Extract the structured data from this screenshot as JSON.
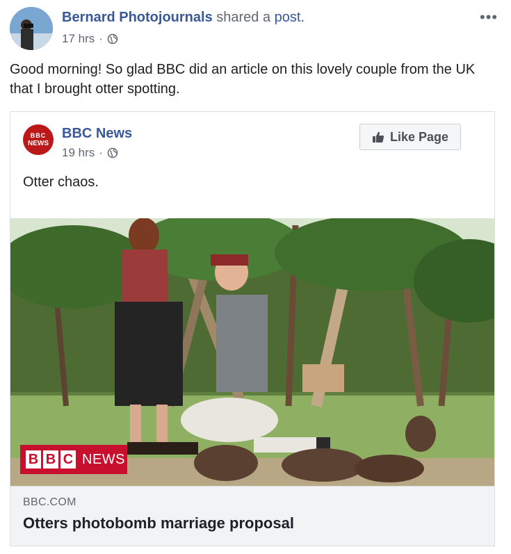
{
  "post": {
    "author_name": "Bernard Photojournals",
    "author_action": "shared a",
    "author_link": "post.",
    "time": "17 hrs",
    "dot": "·",
    "more_icon": "more-horizontal-icon",
    "text": "Good morning! So glad BBC did an article on this lovely couple from the UK that I brought otter spotting."
  },
  "shared": {
    "page_name": "BBC News",
    "logo_line1": "BBC",
    "logo_line2": "NEWS",
    "time": "19 hrs",
    "dot": "·",
    "like_label": "Like Page",
    "like_icon": "thumbs-up-icon",
    "text": "Otter chaos.",
    "photo_banner": {
      "letters": [
        "B",
        "B",
        "C"
      ],
      "word": "NEWS"
    },
    "link_domain": "BBC.COM",
    "link_title": "Otters photobomb marriage proposal"
  },
  "colors": {
    "link_blue": "#385898",
    "meta_gray": "#606770",
    "bbc_red": "#bb1919",
    "link_box_bg": "#f2f3f5"
  }
}
